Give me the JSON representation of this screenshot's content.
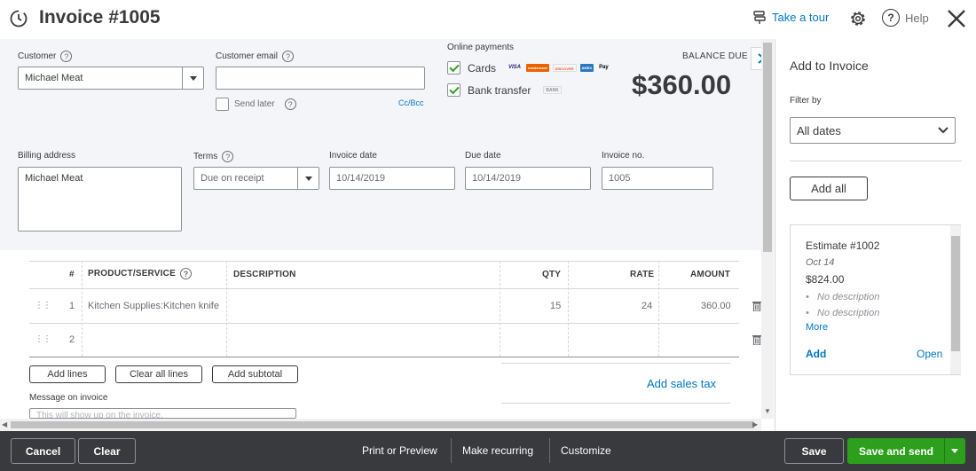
{
  "header": {
    "title": "Invoice #1005",
    "take_tour": "Take a tour",
    "help": "Help"
  },
  "customer": {
    "label": "Customer",
    "value": "Michael Meat"
  },
  "customer_email": {
    "label": "Customer email",
    "value": "",
    "send_later": "Send later",
    "cc_bcc": "Cc/Bcc"
  },
  "online_payments": {
    "label": "Online payments",
    "cards": {
      "label": "Cards",
      "checked": true,
      "logos": [
        "VISA",
        "mastercard",
        "DISCOVER",
        "AMEX",
        "Pay"
      ]
    },
    "bank_transfer": {
      "label": "Bank transfer",
      "checked": true,
      "logo": "BANK"
    }
  },
  "balance": {
    "label": "BALANCE DUE",
    "amount": "$360.00"
  },
  "billing_address": {
    "label": "Billing address",
    "value": "Michael Meat"
  },
  "terms": {
    "label": "Terms",
    "value": "Due on receipt"
  },
  "invoice_date": {
    "label": "Invoice date",
    "value": "10/14/2019"
  },
  "due_date": {
    "label": "Due date",
    "value": "10/14/2019"
  },
  "invoice_no": {
    "label": "Invoice no.",
    "value": "1005"
  },
  "table": {
    "headers": {
      "num": "#",
      "product": "PRODUCT/SERVICE",
      "description": "DESCRIPTION",
      "qty": "QTY",
      "rate": "RATE",
      "amount": "AMOUNT"
    },
    "rows": [
      {
        "num": "1",
        "product": "Kitchen Supplies:Kitchen knife",
        "description": "",
        "qty": "15",
        "rate": "24",
        "amount": "360.00"
      },
      {
        "num": "2",
        "product": "",
        "description": "",
        "qty": "",
        "rate": "",
        "amount": ""
      }
    ]
  },
  "actions": {
    "add_lines": "Add lines",
    "clear_all_lines": "Clear all lines",
    "add_subtotal": "Add subtotal",
    "add_sales_tax": "Add sales tax"
  },
  "message": {
    "label": "Message on invoice",
    "placeholder": "This will show up on the invoice."
  },
  "side_panel": {
    "title": "Add to Invoice",
    "filter_label": "Filter by",
    "filter_value": "All dates",
    "add_all": "Add all",
    "estimate": {
      "title": "Estimate #1002",
      "date": "Oct 14",
      "amount": "$824.00",
      "items": [
        "No description",
        "No description"
      ],
      "more": "More",
      "add": "Add",
      "status": "Open"
    }
  },
  "footer": {
    "cancel": "Cancel",
    "clear": "Clear",
    "print_preview": "Print or Preview",
    "make_recurring": "Make recurring",
    "customize": "Customize",
    "save": "Save",
    "save_and_send": "Save and send"
  },
  "colors": {
    "accent_green": "#2ca01c",
    "link_blue": "#0077c5",
    "footer_bg": "#393a3d",
    "form_bg": "#f4f5f8"
  }
}
